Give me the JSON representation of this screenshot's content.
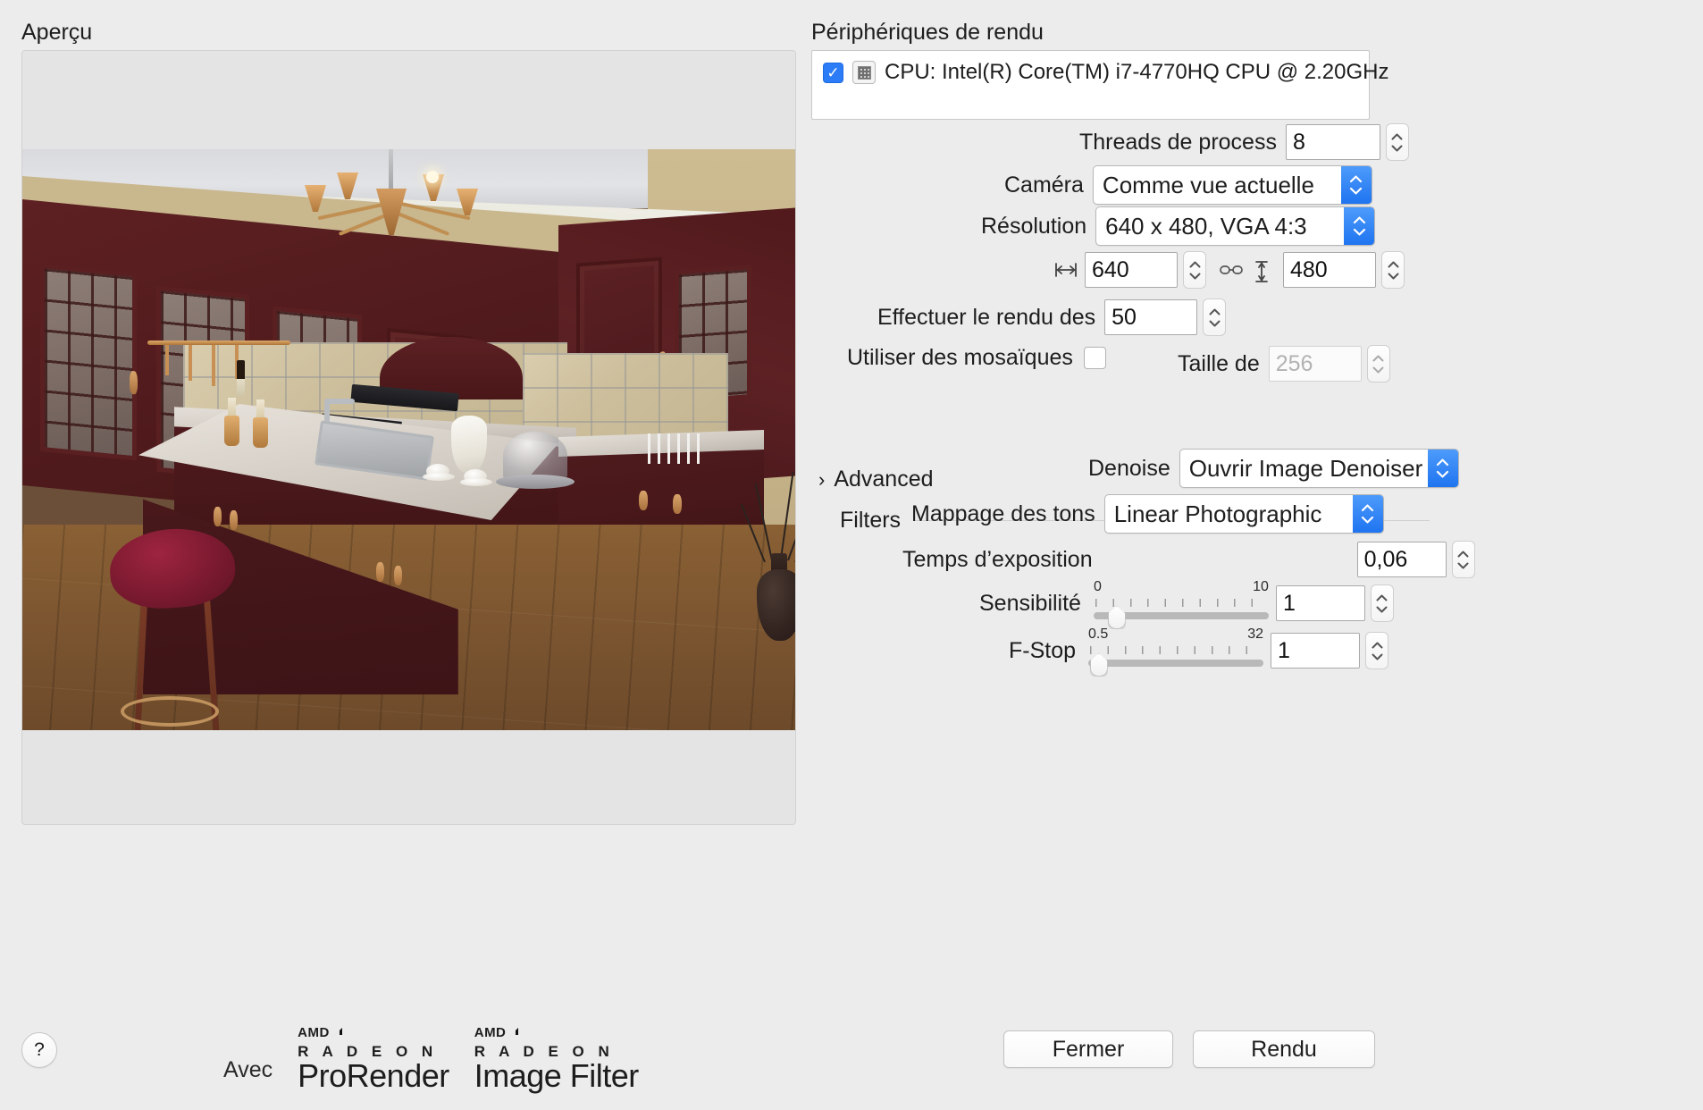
{
  "preview": {
    "title": "Aperçu",
    "scene_description": "Rendu 3D d'une cuisine en acajou avec îlot central, évier, tabouret rouge et lustre"
  },
  "devices": {
    "title": "Périphériques de rendu",
    "items": [
      {
        "label": "CPU: Intel(R) Core(TM) i7-4770HQ CPU @ 2.20GHz",
        "checked": true,
        "icon": "cpu-chip-icon"
      }
    ]
  },
  "settings": {
    "threads_label": "Threads de process",
    "threads_value": "8",
    "camera_label": "Caméra",
    "camera_value": "Comme vue actuelle",
    "resolution_label": "Résolution",
    "resolution_value": "640 x 480, VGA 4:3",
    "width_value": "640",
    "height_value": "480",
    "width_icon": "horizontal-arrows-icon",
    "link_icon": "chain-link-icon",
    "height_icon": "vertical-arrows-icon",
    "passes_label": "Effectuer le rendu des",
    "passes_value": "50",
    "tiles_label": "Utiliser des mosaïques",
    "tiles_checked": false,
    "tile_size_label": "Taille de",
    "tile_size_value": "256",
    "tile_size_disabled": true,
    "advanced_label": "Advanced",
    "advanced_caret": "›",
    "advanced_expanded": false
  },
  "filters": {
    "title": "Filters",
    "denoise_label": "Denoise",
    "denoise_value": "Ouvrir Image Denoiser",
    "tonemap_label": "Mappage des tons",
    "tonemap_value": "Linear Photographic",
    "exposure_label": "Temps d’exposition",
    "exposure_value": "0,06",
    "sensitivity_label": "Sensibilité",
    "sensitivity_value": "1",
    "sensitivity_min": "0",
    "sensitivity_max": "10",
    "sensitivity_pct": 9,
    "fstop_label": "F-Stop",
    "fstop_value": "1",
    "fstop_min": "0.5",
    "fstop_max": "32",
    "fstop_pct": 1
  },
  "footer": {
    "help_label": "?",
    "avec_label": "Avec",
    "logo1": {
      "brand": "AMD",
      "family": "R A D E O N",
      "product": "ProRender"
    },
    "logo2": {
      "brand": "AMD",
      "family": "R A D E O N",
      "product": "Image Filter"
    },
    "close_label": "Fermer",
    "render_label": "Rendu"
  },
  "colors": {
    "accent_blue": "#2b7cf6",
    "window_bg": "#ececec",
    "field_bg": "#ffffff"
  }
}
